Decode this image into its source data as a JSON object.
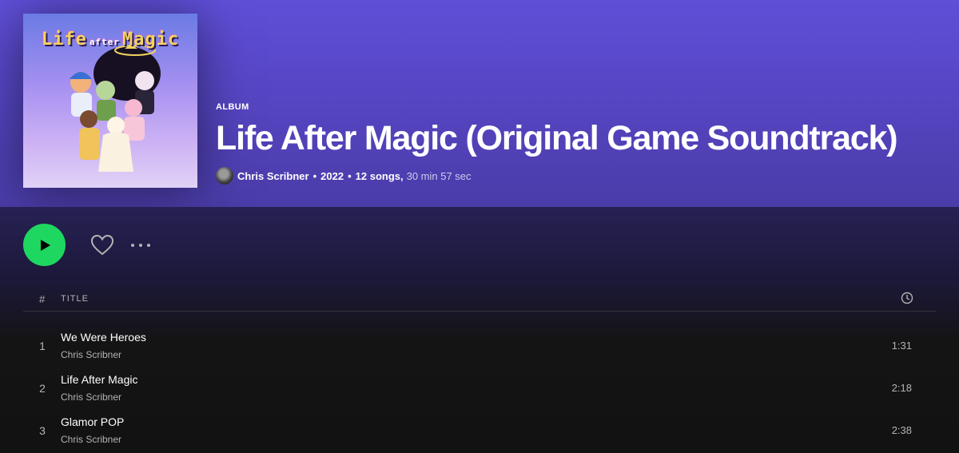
{
  "album": {
    "kind": "ALBUM",
    "title": "Life After Magic (Original Game Soundtrack)",
    "artist": "Chris Scribner",
    "year": "2022",
    "song_count": "12 songs,",
    "duration": "30 min 57 sec",
    "separator": "•",
    "cover_text": {
      "word1": "Life",
      "word2": "after",
      "word3": "Magic"
    }
  },
  "controls": {
    "play_icon": "play-icon",
    "like_icon": "heart-icon",
    "more_icon": "more-horizontal-icon"
  },
  "list": {
    "header": {
      "num": "#",
      "title": "Title",
      "duration_icon": "clock-icon"
    },
    "tracks": [
      {
        "num": "1",
        "name": "We Were Heroes",
        "artist": "Chris Scribner",
        "duration": "1:31"
      },
      {
        "num": "2",
        "name": "Life After Magic",
        "artist": "Chris Scribner",
        "duration": "2:18"
      },
      {
        "num": "3",
        "name": "Glamor POP",
        "artist": "Chris Scribner",
        "duration": "2:38"
      }
    ]
  },
  "colors": {
    "accent_green": "#1ed760",
    "header_purple": "#5f4fd8",
    "text_secondary": "#b3b3b3"
  }
}
